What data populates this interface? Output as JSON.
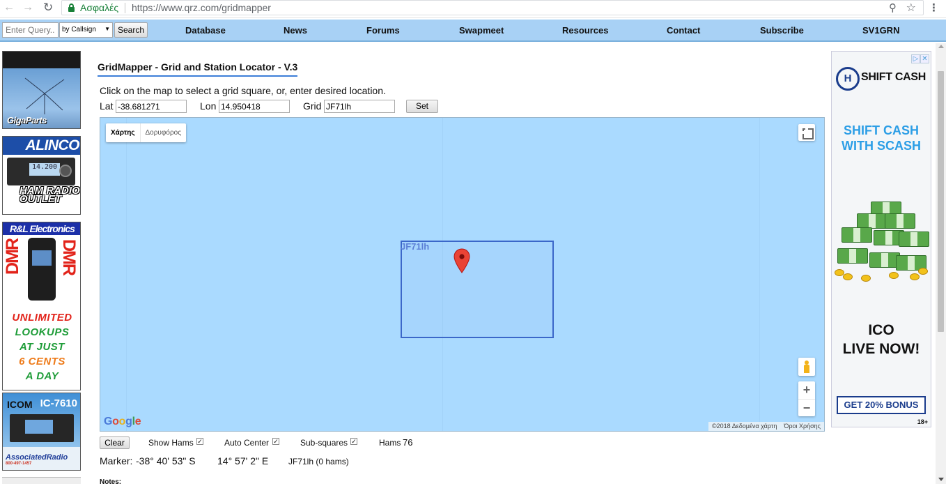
{
  "browser": {
    "secure_label": "Ασφαλές",
    "url": "https://www.qrz.com/gridmapper"
  },
  "nav": {
    "query_placeholder": "Enter Query...",
    "search_by": "by Callsign",
    "search_button": "Search",
    "links": [
      "Database",
      "News",
      "Forums",
      "Swapmeet",
      "Resources",
      "Contact",
      "Subscribe",
      "SV1GRN"
    ]
  },
  "left_ads": {
    "gigaparts": "GigaParts",
    "alinco_title": "ALINCO",
    "alinco_subtitle": "HAM RADIO OUTLET",
    "rl_title": "R&L Electronics",
    "rl_dmr": "DMR",
    "rl_promo": [
      "UNLIMITED",
      "LOOKUPS",
      "AT JUST",
      "6 CENTS",
      "A DAY"
    ],
    "icom_brand": "ICOM",
    "icom_model": "IC-7610",
    "associated": "AssociatedRadio",
    "associated_phone": "800-497-1457"
  },
  "page": {
    "title": "GridMapper - Grid and Station Locator - V.3",
    "instructions": "Click on the map to select a grid square, or, enter desired location."
  },
  "form": {
    "lat_label": "Lat",
    "lat_value": "-38.681271",
    "lon_label": "Lon",
    "lon_value": "14.950418",
    "grid_label": "Grid",
    "grid_value": "JF71lh",
    "set_button": "Set"
  },
  "map": {
    "type_map": "Χάρτης",
    "type_satellite": "Δορυφόρος",
    "grid_square_label": "JF71lh",
    "google": [
      "G",
      "o",
      "o",
      "g",
      "l",
      "e"
    ],
    "attribution_data": "©2018 Δεδομένα χάρτη",
    "attribution_terms": "Όροι Χρήσης",
    "zoom_in": "+",
    "zoom_out": "−"
  },
  "options": {
    "clear_button": "Clear",
    "show_hams_label": "Show Hams",
    "show_hams_checked": true,
    "auto_center_label": "Auto Center",
    "auto_center_checked": true,
    "sub_squares_label": "Sub-squares",
    "sub_squares_checked": true,
    "hams_label": "Hams",
    "hams_count": "76",
    "check_glyph": "✓"
  },
  "marker": {
    "label": "Marker:",
    "lat_dms": "-38° 40' 53\" S",
    "lon_dms": "14° 57' 2\" E",
    "grid_info": "JF71lh (0 hams)"
  },
  "notes_label": "Notes:",
  "right_ad": {
    "brand": "SHIFT CASH",
    "headline": [
      "SHIFT CASH",
      "WITH SCASH"
    ],
    "ico": [
      "ICO",
      "LIVE NOW!"
    ],
    "bonus": "GET 20% BONUS",
    "age": "18+"
  }
}
